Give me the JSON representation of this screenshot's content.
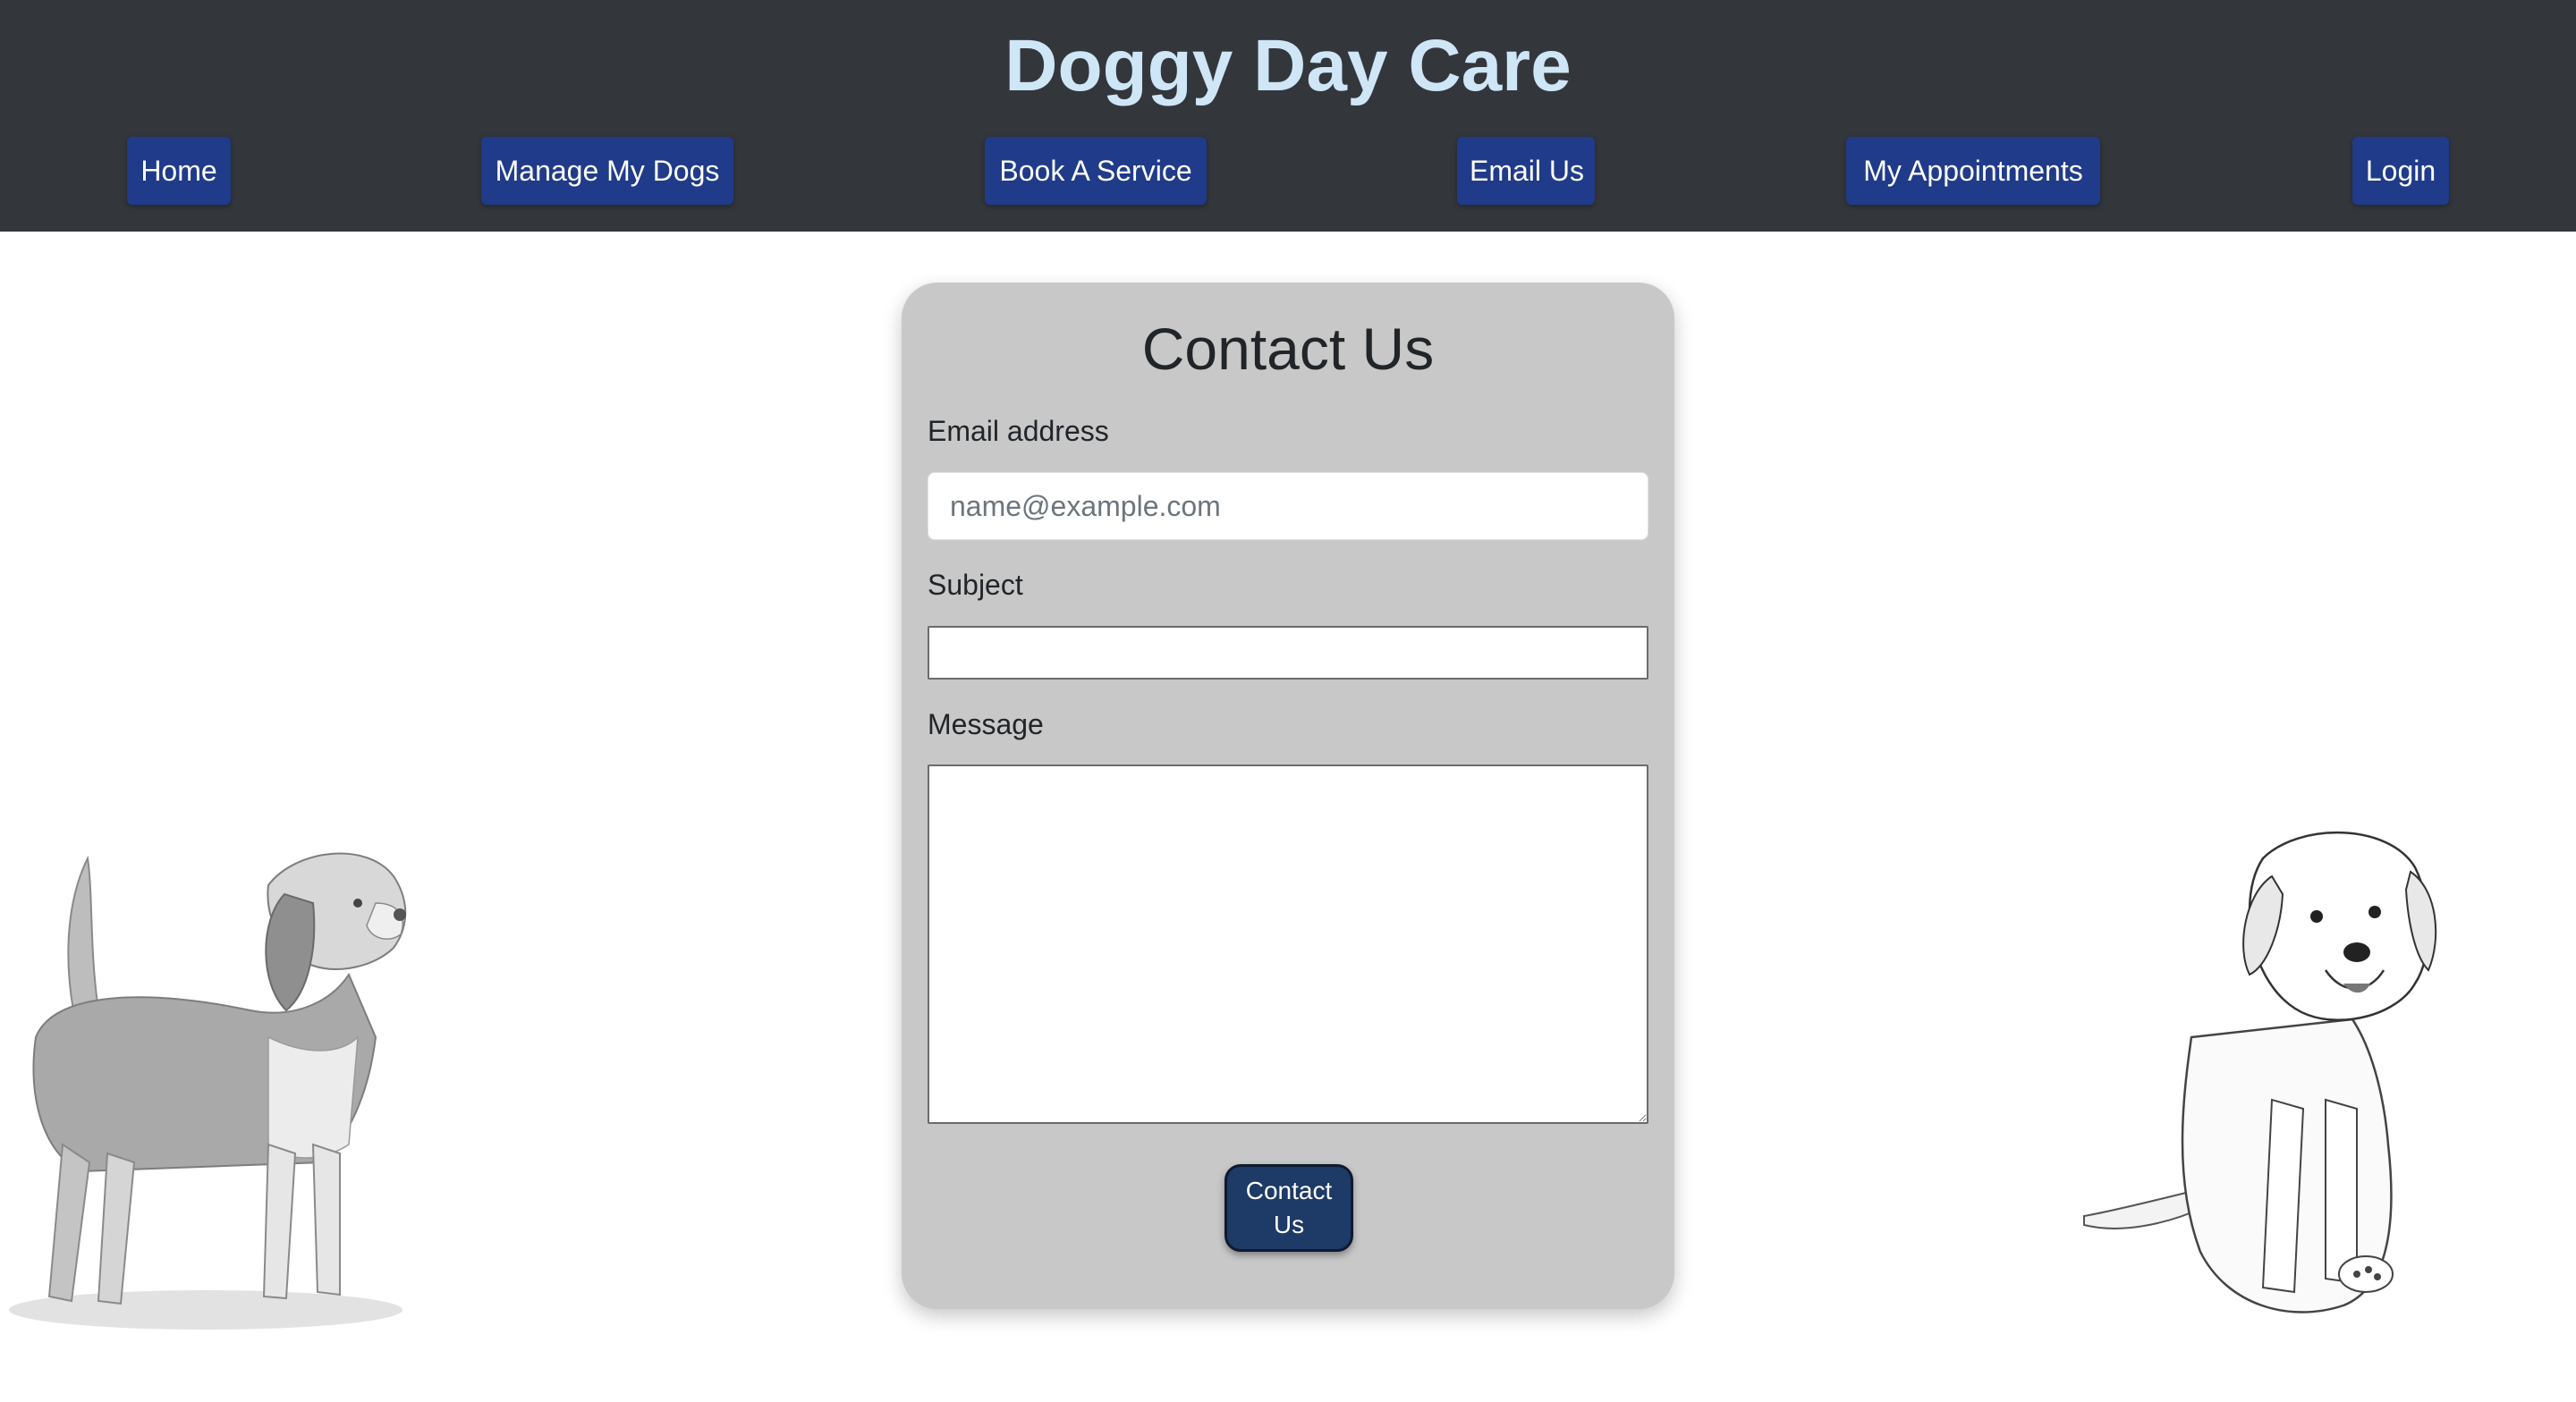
{
  "header": {
    "title": "Doggy Day Care",
    "nav": [
      {
        "label": "Home"
      },
      {
        "label": "Manage My Dogs"
      },
      {
        "label": "Book A Service"
      },
      {
        "label": "Email Us"
      },
      {
        "label": "My Appointments"
      },
      {
        "label": "Login"
      }
    ]
  },
  "contact_form": {
    "title": "Contact Us",
    "email_label": "Email address",
    "email_placeholder": "name@example.com",
    "email_value": "",
    "subject_label": "Subject",
    "subject_value": "",
    "message_label": "Message",
    "message_value": "",
    "submit_label": "Contact Us"
  },
  "colors": {
    "header_bg": "#33373b",
    "title_color": "#cfe6f7",
    "nav_button_bg": "#1f3b8a",
    "card_bg": "#c8c8c8",
    "submit_bg": "#1e3a66"
  },
  "images": {
    "left": "beagle-sketch",
    "right": "puppy-sketch"
  }
}
